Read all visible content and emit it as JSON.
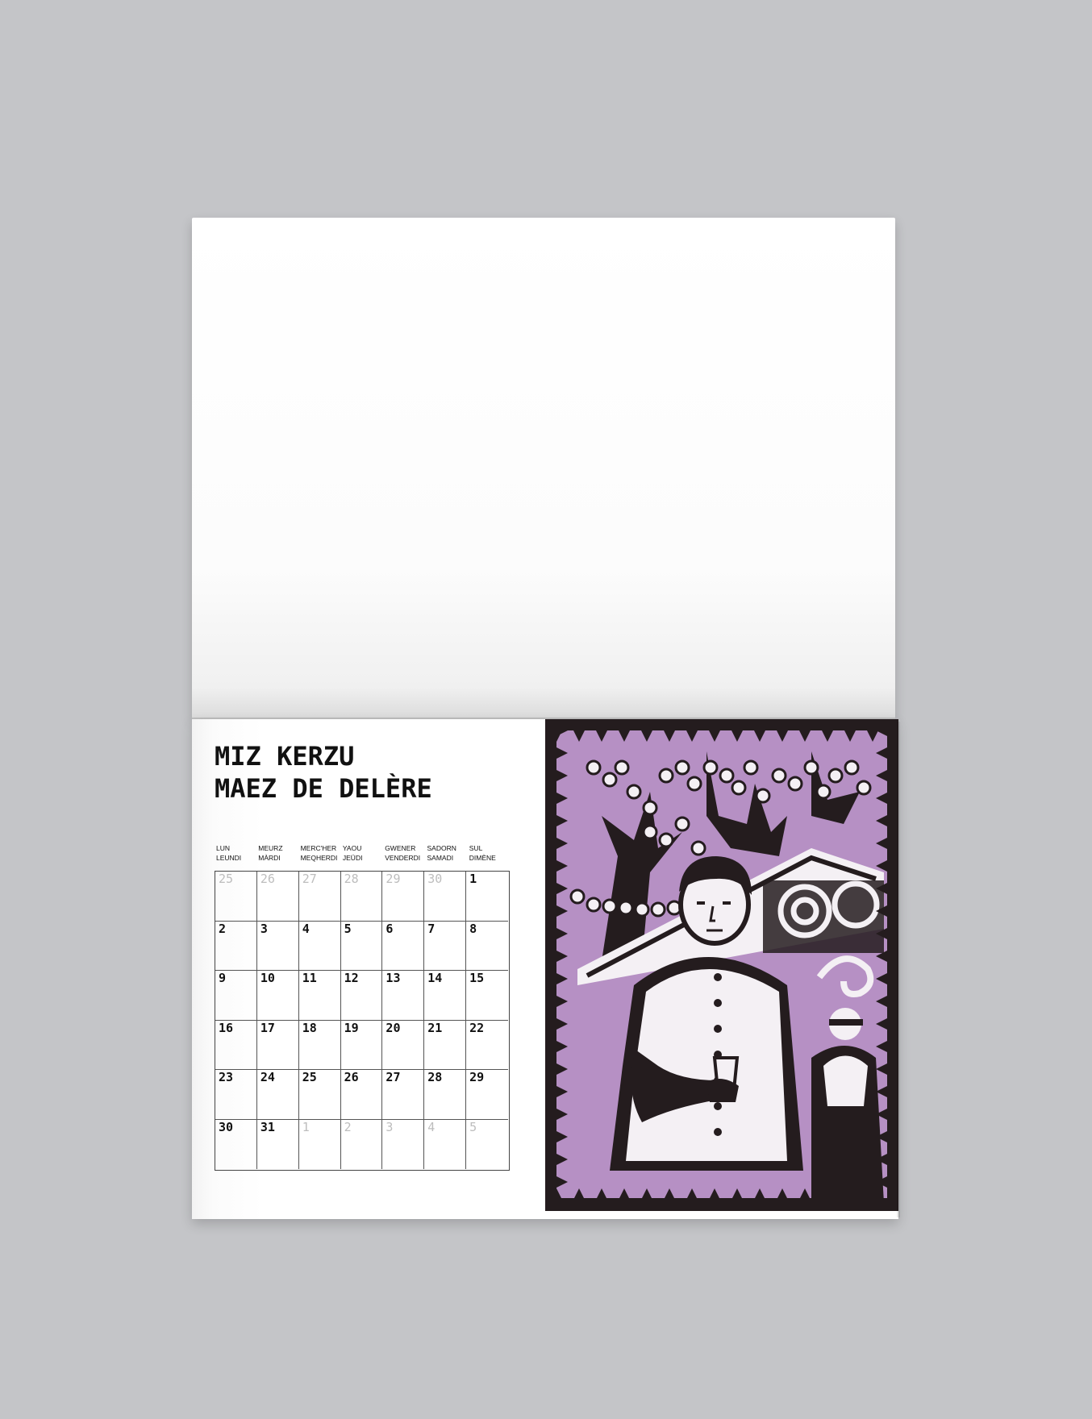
{
  "calendar": {
    "title_line1": "MIZ KERZU",
    "title_line2": "MAEZ DE DELÈRE",
    "day_headers": [
      {
        "l1": "LUN",
        "l2": "LEUNDI"
      },
      {
        "l1": "MEURZ",
        "l2": "MÀRDI"
      },
      {
        "l1": "MERC'HER",
        "l2": "MEQHERDI"
      },
      {
        "l1": "YAOU",
        "l2": "JEÜDI"
      },
      {
        "l1": "GWENER",
        "l2": "VENDERDI"
      },
      {
        "l1": "SADORN",
        "l2": "SAMADI"
      },
      {
        "l1": "SUL",
        "l2": "DIMÈNE"
      }
    ],
    "weeks": [
      [
        {
          "d": "25",
          "m": true
        },
        {
          "d": "26",
          "m": true
        },
        {
          "d": "27",
          "m": true
        },
        {
          "d": "28",
          "m": true
        },
        {
          "d": "29",
          "m": true
        },
        {
          "d": "30",
          "m": true
        },
        {
          "d": "1",
          "m": false
        }
      ],
      [
        {
          "d": "2",
          "m": false
        },
        {
          "d": "3",
          "m": false
        },
        {
          "d": "4",
          "m": false
        },
        {
          "d": "5",
          "m": false
        },
        {
          "d": "6",
          "m": false
        },
        {
          "d": "7",
          "m": false
        },
        {
          "d": "8",
          "m": false
        }
      ],
      [
        {
          "d": "9",
          "m": false
        },
        {
          "d": "10",
          "m": false
        },
        {
          "d": "11",
          "m": false
        },
        {
          "d": "12",
          "m": false
        },
        {
          "d": "13",
          "m": false
        },
        {
          "d": "14",
          "m": false
        },
        {
          "d": "15",
          "m": false
        }
      ],
      [
        {
          "d": "16",
          "m": false
        },
        {
          "d": "17",
          "m": false
        },
        {
          "d": "18",
          "m": false
        },
        {
          "d": "19",
          "m": false
        },
        {
          "d": "20",
          "m": false
        },
        {
          "d": "21",
          "m": false
        },
        {
          "d": "22",
          "m": false
        }
      ],
      [
        {
          "d": "23",
          "m": false
        },
        {
          "d": "24",
          "m": false
        },
        {
          "d": "25",
          "m": false
        },
        {
          "d": "26",
          "m": false
        },
        {
          "d": "27",
          "m": false
        },
        {
          "d": "28",
          "m": false
        },
        {
          "d": "29",
          "m": false
        }
      ],
      [
        {
          "d": "30",
          "m": false
        },
        {
          "d": "31",
          "m": false
        },
        {
          "d": "1",
          "m": true
        },
        {
          "d": "2",
          "m": true
        },
        {
          "d": "3",
          "m": true
        },
        {
          "d": "4",
          "m": true
        },
        {
          "d": "5",
          "m": true
        }
      ]
    ]
  },
  "illustration": {
    "subject": "linocut-person-holding-glass-under-tree",
    "colors": {
      "lilac": "#b690c4",
      "dark": "#241c1e",
      "light": "#f4f0f4"
    }
  }
}
